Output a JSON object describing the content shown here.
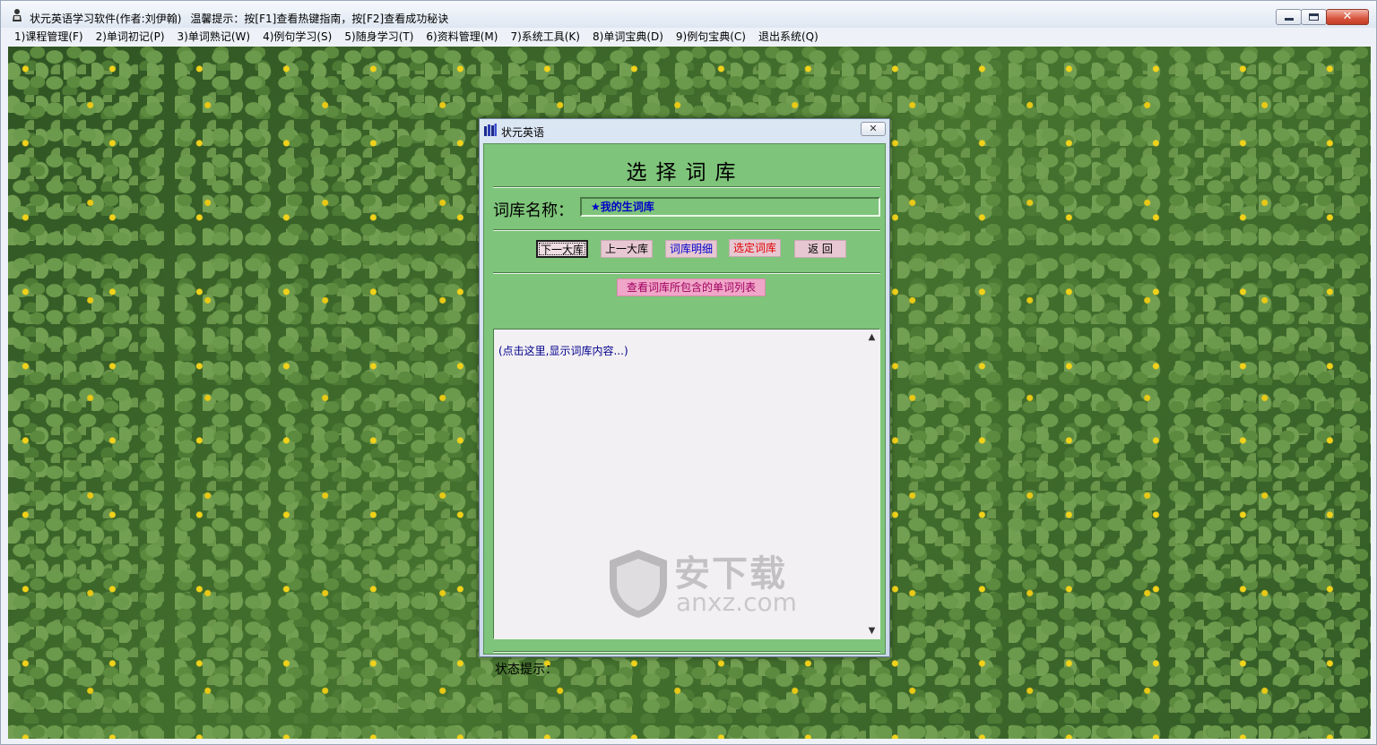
{
  "window": {
    "title": "状元英语学习软件(作者:刘伊翰)",
    "hint": "温馨提示：按[F1]查看热键指南，按[F2]查看成功秘诀",
    "close_glyph": "✕"
  },
  "menu": [
    "1)课程管理(F)",
    "2)单词初记(P)",
    "3)单词熟记(W)",
    "4)例句学习(S)",
    "5)随身学习(T)",
    "6)资料管理(M)",
    "7)系统工具(K)",
    "8)单词宝典(D)",
    "9)例句宝典(C)",
    "退出系统(Q)"
  ],
  "dialog": {
    "title": "状元英语",
    "close_glyph": "✕",
    "heading": "选择词库",
    "lib_label": "词库名称：",
    "lib_value": "★我的生词库",
    "buttons": {
      "next": "下一大库",
      "prev": "上一大库",
      "detail": "词库明细",
      "select": "选定词库",
      "back": "返 回",
      "view_words": "查看词库所包含的单词列表"
    },
    "content_placeholder": "(点击这里,显示词库内容...)",
    "status_label": "状态提示：",
    "scroll_up": "▲",
    "scroll_down": "▼"
  },
  "watermark": {
    "cn": "安下载",
    "en": "anxz.com",
    "shield_char": "安"
  },
  "colors": {
    "dialog_body": "#7ec47a",
    "button_pink": "#e7c8d2",
    "field_text": "#0000c8"
  },
  "icons": {
    "app": "person-icon",
    "dialog": "books-icon"
  }
}
